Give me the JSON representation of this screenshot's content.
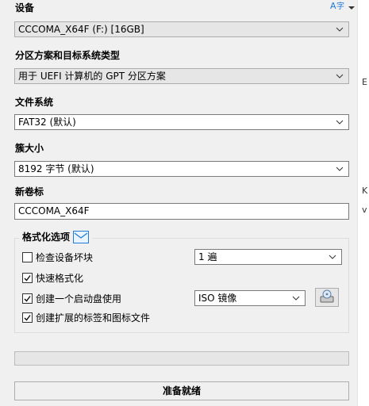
{
  "device": {
    "label": "设备",
    "value": "CCCOMA_X64F (F:) [16GB]"
  },
  "partition": {
    "label": "分区方案和目标系统类型",
    "value": "用于 UEFI 计算机的 GPT 分区方案"
  },
  "filesystem": {
    "label": "文件系统",
    "value": "FAT32 (默认)"
  },
  "cluster": {
    "label": "簇大小",
    "value": "8192 字节 (默认)"
  },
  "volume": {
    "label": "新卷标",
    "value": "CCCOMA_X64F"
  },
  "format_options": {
    "title": "格式化选项",
    "bad_blocks": {
      "label": "检查设备坏块",
      "checked": false,
      "passes": "1 遍"
    },
    "quick_format": {
      "label": "快速格式化",
      "checked": true
    },
    "bootable": {
      "label": "创建一个启动盘使用",
      "checked": true,
      "image_type": "ISO 镜像"
    },
    "extended_label": {
      "label": "创建扩展的标签和图标文件",
      "checked": true
    }
  },
  "progress": {
    "fraction": 0
  },
  "status": {
    "text": "准备就绪"
  },
  "edge_glyphs": {
    "g1": "E",
    "g2": "K",
    "g3": "v"
  },
  "icons": {
    "language": "language-icon",
    "disk": "disk-image-icon",
    "mail": "mail-icon"
  }
}
